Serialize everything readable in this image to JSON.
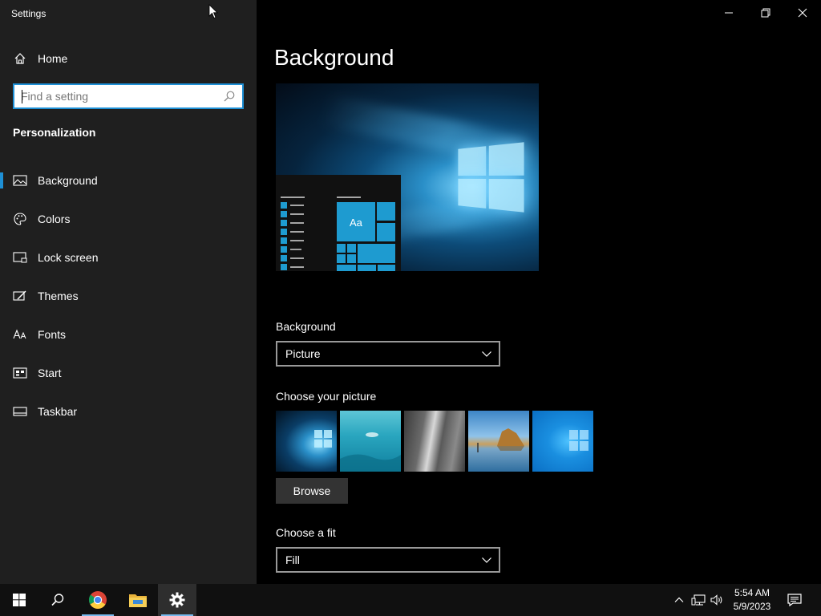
{
  "window": {
    "title": "Settings"
  },
  "sidebar": {
    "home_label": "Home",
    "search_placeholder": "Find a setting",
    "section_title": "Personalization",
    "items": [
      {
        "label": "Background",
        "icon": "picture-icon",
        "active": true
      },
      {
        "label": "Colors",
        "icon": "palette-icon",
        "active": false
      },
      {
        "label": "Lock screen",
        "icon": "lock-screen-icon",
        "active": false
      },
      {
        "label": "Themes",
        "icon": "themes-icon",
        "active": false
      },
      {
        "label": "Fonts",
        "icon": "fonts-icon",
        "active": false
      },
      {
        "label": "Start",
        "icon": "start-icon",
        "active": false
      },
      {
        "label": "Taskbar",
        "icon": "taskbar-icon",
        "active": false
      }
    ]
  },
  "main": {
    "page_title": "Background",
    "preview_tile_text": "Aa",
    "background_label": "Background",
    "background_value": "Picture",
    "choose_picture_label": "Choose your picture",
    "pictures": [
      "windows-hero",
      "underwater-swimmer",
      "rock-cliff",
      "beach-rocks",
      "windows-blue"
    ],
    "browse_label": "Browse",
    "fit_label": "Choose a fit",
    "fit_value": "Fill"
  },
  "taskbar": {
    "apps": [
      "start-icon",
      "search-icon",
      "chrome-icon",
      "file-explorer-icon",
      "settings-icon"
    ],
    "clock_time": "5:54 AM",
    "clock_date": "5/9/2023"
  },
  "colors": {
    "accent": "#1e90d6",
    "sidebar_bg": "#1f1f1f",
    "main_bg": "#000000",
    "taskbar_bg": "#101010"
  }
}
